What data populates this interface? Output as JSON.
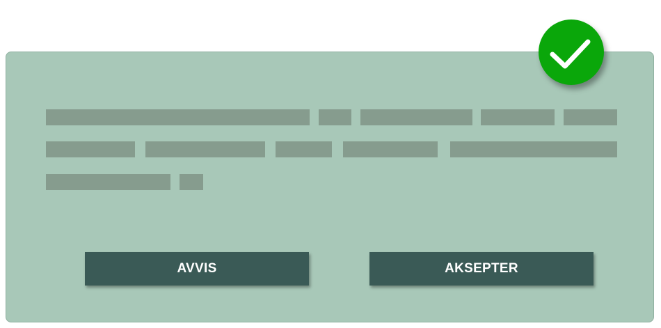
{
  "dialog": {
    "reject_label": "AVVIS",
    "accept_label": "AKSEPTER",
    "status_icon": "checkmark-icon",
    "colors": {
      "card_background": "#a8c8b8",
      "placeholder_text": "#869c8e",
      "button_background": "#3a5a56",
      "button_text": "#ffffff",
      "status_badge": "#0aa70a"
    }
  }
}
